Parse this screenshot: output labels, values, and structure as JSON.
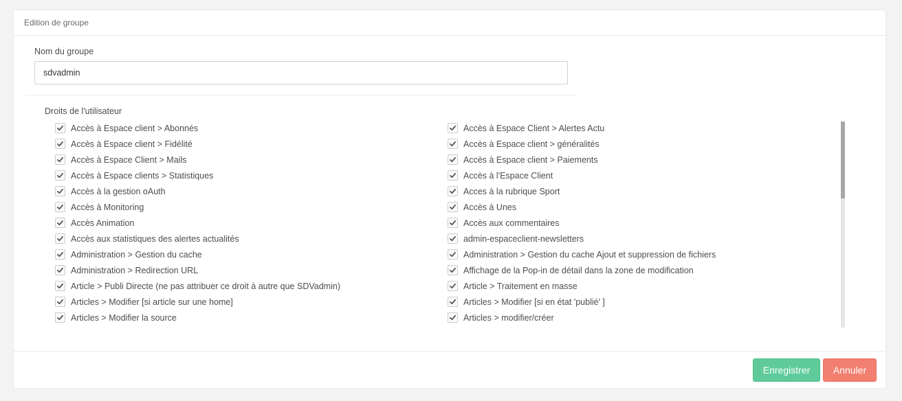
{
  "panel": {
    "title": "Edition de groupe"
  },
  "group_name": {
    "label": "Nom du groupe",
    "value": "sdvadmin"
  },
  "rights": {
    "label": "Droits de l'utilisateur",
    "left": [
      "Accès à Espace client > Abonnés",
      "Accès à Espace client > Fidélité",
      "Accès à Espace Client > Mails",
      "Accès à Espace clients > Statistiques",
      "Accès à la gestion oAuth",
      "Accès à Monitoring",
      "Accès Animation",
      "Accès aux statistiques des alertes actualités",
      "Administration > Gestion du cache",
      "Administration > Redirection URL",
      "Article > Publi Directe (ne pas attribuer ce droit à autre que SDVadmin)",
      "Articles > Modifier [si article sur une home]",
      "Articles > Modifier la source"
    ],
    "right": [
      "Accès à Espace Client > Alertes Actu",
      "Accès à Espace client > généralités",
      "Accès à Espace client > Paiements",
      "Accès à l'Espace Client",
      "Acces à la rubrique Sport",
      "Accès à Unes",
      "Accès aux commentaires",
      "admin-espaceclient-newsletters",
      "Administration > Gestion du cache Ajout et suppression de fichiers",
      "Affichage de la Pop-in de détail dans la zone de modification",
      "Article > Traitement en masse",
      "Articles > Modifier [si en état 'publié' ]",
      "Articles > modifier/créer"
    ]
  },
  "buttons": {
    "save": "Enregistrer",
    "cancel": "Annuler"
  },
  "colors": {
    "save": "#5fcb9b",
    "cancel": "#f27f6f"
  },
  "icons": {
    "checkbox": "checkmark-icon"
  }
}
